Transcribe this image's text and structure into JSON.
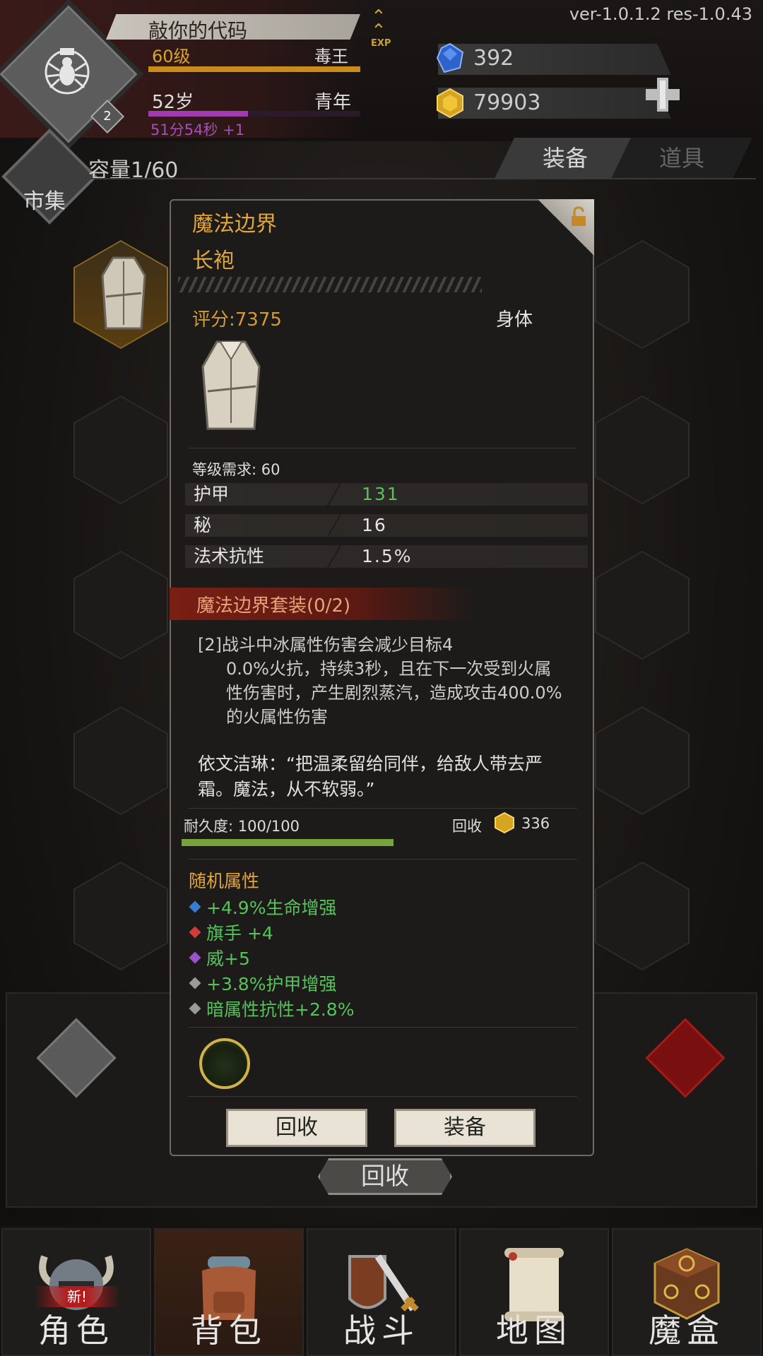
{
  "header": {
    "player_name": "敲你的代码",
    "level": "60级",
    "class": "毒王",
    "level_progress": 1.0,
    "age": "52岁",
    "age_stage": "青年",
    "age_progress": 0.47,
    "timer": "51分54秒 +1",
    "badge": "2",
    "exp_label": "EXP",
    "version": "ver-1.0.1.2  res-1.0.43",
    "sapphires": "392",
    "gold": "79903"
  },
  "inventory": {
    "market_label": "市集",
    "capacity": "容量1/60",
    "tabs": [
      "装备",
      "道具"
    ]
  },
  "item": {
    "name": "魔法边界",
    "type": "长袍",
    "score": "评分:7375",
    "slot": "身体",
    "level_req": "等级需求: 60",
    "stats": [
      {
        "key": "护甲",
        "value": "131",
        "highlight": true
      },
      {
        "key": "秘",
        "value": "16",
        "highlight": false
      },
      {
        "key": "法术抗性",
        "value": "1.5%",
        "highlight": false
      }
    ],
    "set_title": "魔法边界套装(0/2)",
    "set_desc_first": "[2]战斗中冰属性伤害会减少目标4",
    "set_desc_rest": "0.0%火抗，持续3秒，且在下一次受到火属性伤害时，产生剧烈蒸汽，造成攻击400.0%的火属性伤害",
    "quote": "依文洁琳：“把温柔留给同伴，给敌人带去严霜。魔法，从不软弱。”",
    "durability": "耐久度: 100/100",
    "durability_ratio": 1.0,
    "recycle_label": "回收",
    "recycle_value": "336",
    "random_title": "随机属性",
    "affixes": [
      {
        "text": "+4.9%生命增强",
        "gem_color": "#3a7bd5"
      },
      {
        "text": "旗手 +4",
        "gem_color": "#d33b3b"
      },
      {
        "text": "威+5",
        "gem_color": "#9a54c9"
      },
      {
        "text": "+3.8%护甲增强",
        "gem_color": "#9a9a9a"
      },
      {
        "text": "暗属性抗性+2.8%",
        "gem_color": "#9a9a9a"
      }
    ],
    "btn_recycle": "回收",
    "btn_equip": "装备"
  },
  "background": {
    "recycle_button": "回收"
  },
  "nav": [
    {
      "label": "角色",
      "badge": "新!"
    },
    {
      "label": "背包"
    },
    {
      "label": "战斗"
    },
    {
      "label": "地图"
    },
    {
      "label": "魔盒"
    }
  ]
}
